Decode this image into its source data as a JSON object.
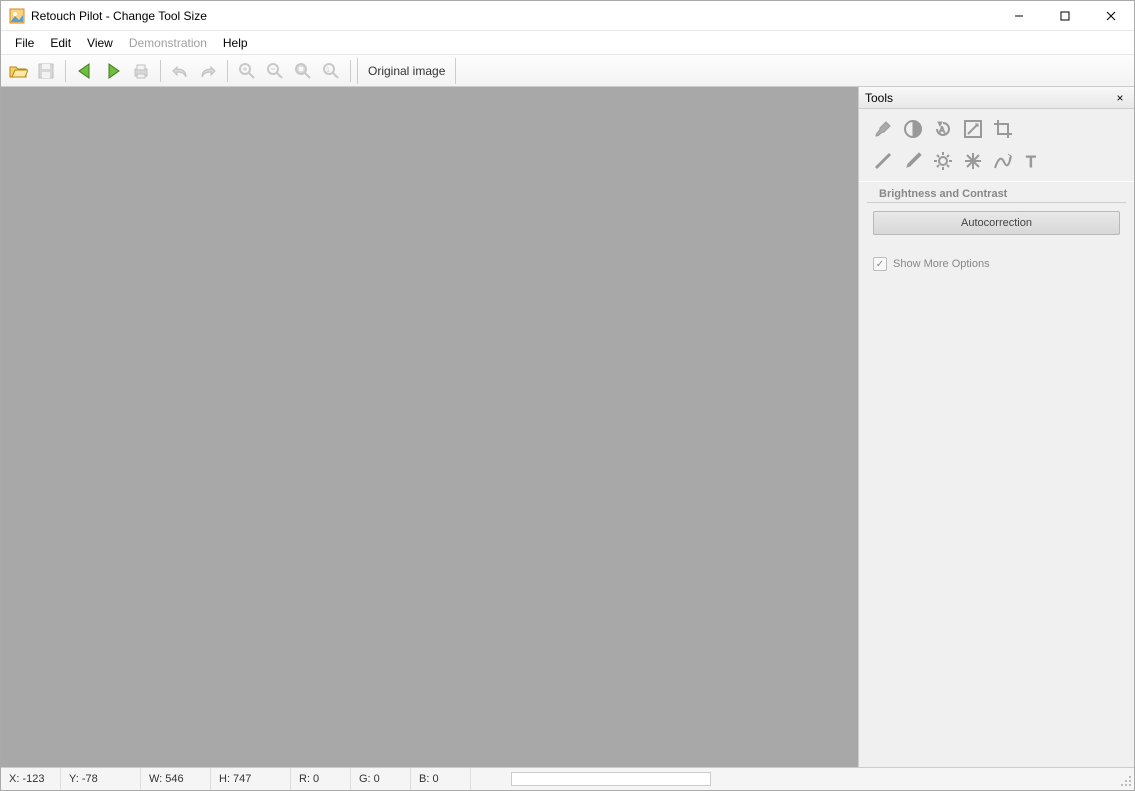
{
  "window": {
    "title": "Retouch Pilot - Change Tool Size"
  },
  "menu": {
    "file": "File",
    "edit": "Edit",
    "view": "View",
    "demonstration": "Demonstration",
    "help": "Help"
  },
  "toolbar": {
    "original_image": "Original image"
  },
  "tools_panel": {
    "title": "Tools",
    "section_label": "Brightness and Contrast",
    "autocorrection": "Autocorrection",
    "show_more": "Show More Options"
  },
  "status": {
    "x": "X: -123",
    "y": "Y: -78",
    "w": "W: 546",
    "h": "H: 747",
    "r": "R: 0",
    "g": "G: 0",
    "b": "B: 0"
  }
}
